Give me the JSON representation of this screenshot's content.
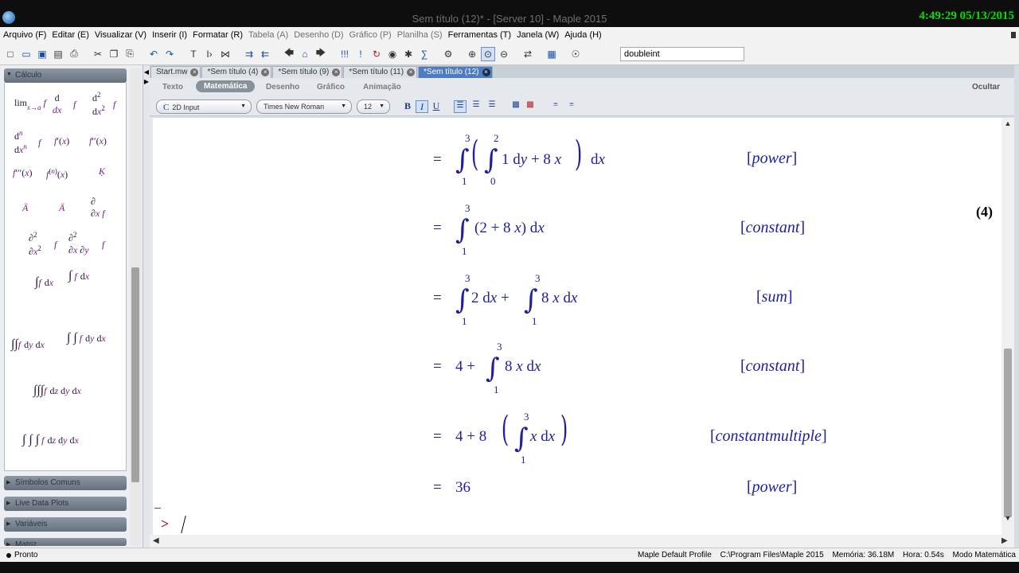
{
  "window": {
    "title": "Sem título (12)* - [Server 10] - Maple 2015",
    "clock": "4:49:29  05/13/2015"
  },
  "menu": [
    {
      "label": "Arquivo (F)",
      "enabled": true
    },
    {
      "label": "Editar (E)",
      "enabled": true
    },
    {
      "label": "Visualizar (V)",
      "enabled": true
    },
    {
      "label": "Inserir (I)",
      "enabled": true
    },
    {
      "label": "Formatar (R)",
      "enabled": true
    },
    {
      "label": "Tabela (A)",
      "enabled": false
    },
    {
      "label": "Desenho (D)",
      "enabled": false
    },
    {
      "label": "Gráfico (P)",
      "enabled": false
    },
    {
      "label": "Planilha (S)",
      "enabled": false
    },
    {
      "label": "Ferramentas (T)",
      "enabled": true
    },
    {
      "label": "Janela (W)",
      "enabled": true
    },
    {
      "label": "Ajuda (H)",
      "enabled": true
    }
  ],
  "toolbar": {
    "search_value": "doubleint"
  },
  "palette": {
    "open_section": "Cálculo",
    "sections": [
      "Símbolos Comuns",
      "Live Data Plots",
      "Variáveis",
      "Matriz"
    ]
  },
  "tabs": [
    {
      "label": "Start.mw",
      "active": false
    },
    {
      "label": "*Sem título (4)",
      "active": false
    },
    {
      "label": "*Sem título (9)",
      "active": false
    },
    {
      "label": "*Sem título (11)",
      "active": false
    },
    {
      "label": "*Sem título (12)",
      "active": true
    }
  ],
  "modes": {
    "items": [
      "Texto",
      "Matemática",
      "Desenho",
      "Gráfico",
      "Animação"
    ],
    "active": "Matemática",
    "hide": "Ocultar"
  },
  "format": {
    "input_mode": "2D Input",
    "font": "Times New Roman",
    "size": "12"
  },
  "document": {
    "equation_label": "(4)",
    "steps": [
      {
        "rhs": "∫₁³ (∫₀² 1 dy + 8 x) dx",
        "reason": "power"
      },
      {
        "rhs": "∫₁³ (2 + 8 x) dx",
        "reason": "constant"
      },
      {
        "rhs": "∫₁³ 2 dx + ∫₁³ 8 x dx",
        "reason": "sum"
      },
      {
        "rhs": "4 + ∫₁³ 8 x dx",
        "reason": "constant"
      },
      {
        "rhs": "4 + 8 (∫₁³ x dx)",
        "reason": "constantmultiple"
      },
      {
        "rhs": "36",
        "reason": "power"
      }
    ],
    "prompt": ">"
  },
  "status": {
    "state": "Pronto",
    "profile": "Maple Default Profile",
    "path": "C:\\Program Files\\Maple 2015",
    "memory": "Memória: 36.18M",
    "time": "Hora: 0.54s",
    "mode": "Modo Matemática"
  }
}
